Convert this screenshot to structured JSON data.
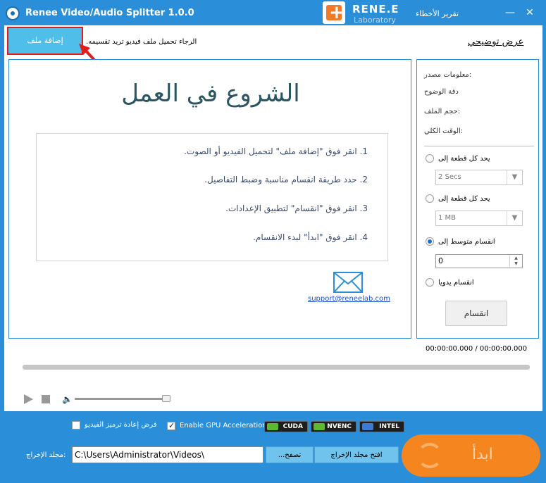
{
  "app": {
    "title": "Renee Video/Audio Splitter 1.0.0"
  },
  "logo": {
    "mark": "+",
    "name": "RENE.E",
    "sub": "Laboratory"
  },
  "titlebar": {
    "report_bug": "تقرير الأخطاء",
    "minimize": "—",
    "close": "✕"
  },
  "toolbar": {
    "add_file": "إضافة ملف",
    "hint": ".الرجاء تحميل ملف فيديو تريد تقسيمه",
    "tutorial": "عرض توضيحي"
  },
  "content": {
    "heading": "الشروع في العمل",
    "steps": [
      "1. انقر فوق \"إضافة ملف\" لتحميل الفيديو أو الصوت.",
      "2. حدد طريقة انقسام مناسبة وضبط التفاصيل.",
      "3. انقر فوق \"انقسام\" لتطبيق الإعدادات.",
      "4. انقر فوق \"ابدأ\" لبدء الانقسام."
    ],
    "support_email": "support@reneelab.com"
  },
  "side": {
    "source_info": "معلومات مصدر:",
    "resolution": "دقة الوضوح",
    "file_size": "حجم الملف:",
    "total_time": "الوقت الكلي:",
    "option_time_label": "يحد كل قطعة إلى",
    "option_time_value": "2 Secs",
    "option_size_label": "يحد كل قطعة إلى",
    "option_size_value": "1 MB",
    "option_avg_label": "انقسام متوسط إلى",
    "option_avg_value": "0",
    "option_manual_label": "انقسام يدويا",
    "split_button": "انقسام",
    "selected_option": "avg"
  },
  "player": {
    "time": "00:00:00.000 / 00:00:00.000",
    "progress": 0,
    "volume": 0.95
  },
  "bottom": {
    "reencode_label": "فرض إعادة ترميز الفيديو",
    "reencode_checked": false,
    "gpu_label": "Enable GPU Acceleration",
    "gpu_checked": true,
    "gpu_badges": [
      "CUDA",
      "NVENC",
      "INTEL"
    ],
    "output_label": "مجلد الإخراج:",
    "output_path": "C:\\Users\\Administrator\\Videos\\",
    "browse": "...تصفح",
    "open_folder": "افتح مجلد الإخراج",
    "start": "ابدأ"
  },
  "colors": {
    "primary": "#2a8fd8",
    "add_file_button": "#4fbfea",
    "start_button": "#f5861f",
    "heading": "#2b5661",
    "annotation_red": "#e41b1b"
  }
}
